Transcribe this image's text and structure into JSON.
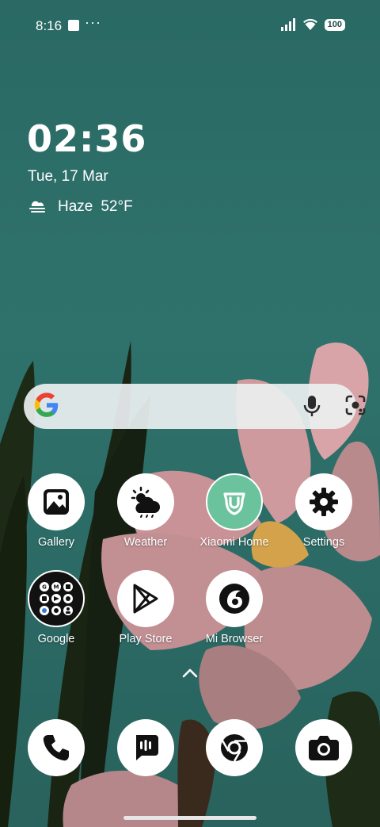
{
  "status_bar": {
    "time": "8:16",
    "more": "···",
    "battery": "100"
  },
  "clock_widget": {
    "time": "02:36",
    "date": "Tue, 17 Mar",
    "condition": "Haze",
    "temperature": "52°F"
  },
  "search_bar": {
    "logo": "google-g-icon",
    "voice": "mic-icon",
    "lens": "lens-icon"
  },
  "apps_row1": [
    {
      "label": "Gallery",
      "icon": "gallery-icon"
    },
    {
      "label": "Weather",
      "icon": "weather-icon"
    },
    {
      "label": "Xiaomi Home",
      "icon": "xiaomi-home-icon"
    },
    {
      "label": "Settings",
      "icon": "settings-gear-icon"
    }
  ],
  "apps_row2": [
    {
      "label": "Google",
      "icon": "google-folder-icon"
    },
    {
      "label": "Play Store",
      "icon": "play-store-icon"
    },
    {
      "label": "Mi Browser",
      "icon": "mi-browser-icon"
    }
  ],
  "dock": [
    {
      "icon": "phone-icon"
    },
    {
      "icon": "messages-icon"
    },
    {
      "icon": "chrome-icon"
    },
    {
      "icon": "camera-icon"
    }
  ],
  "colors": {
    "accent_green": "#6bc39d",
    "wallpaper_teal": "#2f6f68"
  }
}
